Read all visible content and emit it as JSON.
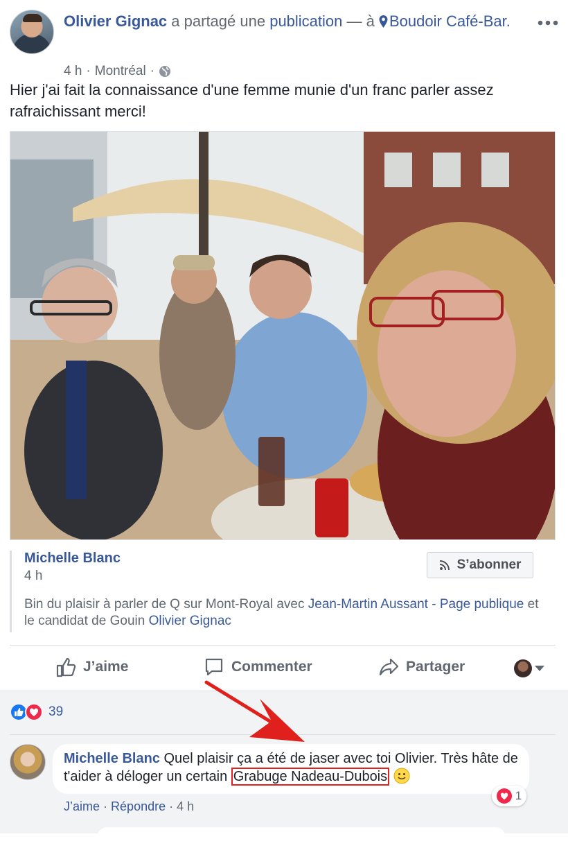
{
  "post": {
    "author": "Olivier Gignac",
    "shared_text": "a partagé une",
    "publication_link": "publication",
    "at_text": "— à",
    "location": "Boudoir Café-Bar.",
    "time": "4 h",
    "place": "Montréal",
    "separator": "·",
    "text": "Hier j'ai fait la connaissance d'une femme munie d'un franc parler assez rafraichissant merci!"
  },
  "shared_post": {
    "author": "Michelle Blanc",
    "time": "4 h",
    "subscribe_label": "S’abonner",
    "text_before": "Bin du plaisir à parler de Q sur Mont-Royal avec",
    "link_1": "Jean-Martin Aussant - Page publique",
    "text_middle": "et le candidat de Gouin",
    "link_2": "Olivier Gignac"
  },
  "actions": {
    "like": "J’aime",
    "comment": "Commenter",
    "share": "Partager"
  },
  "reactions": {
    "count": "39"
  },
  "comment": {
    "author": "Michelle Blanc",
    "text_before": "Quel plaisir ça a été de jaser avec toi Olivier. Très hâte de t'aider à déloger un certain",
    "highlighted": "Grabuge Nadeau-Dubois",
    "reaction_count": "1",
    "like": "J’aime",
    "reply": "Répondre",
    "dot": "·",
    "time": "4 h"
  },
  "colors": {
    "link": "#385898",
    "secondary_text": "#606770",
    "like_blue": "#1877f2",
    "love_red": "#f0284a",
    "annotation_red": "#e0201c"
  }
}
